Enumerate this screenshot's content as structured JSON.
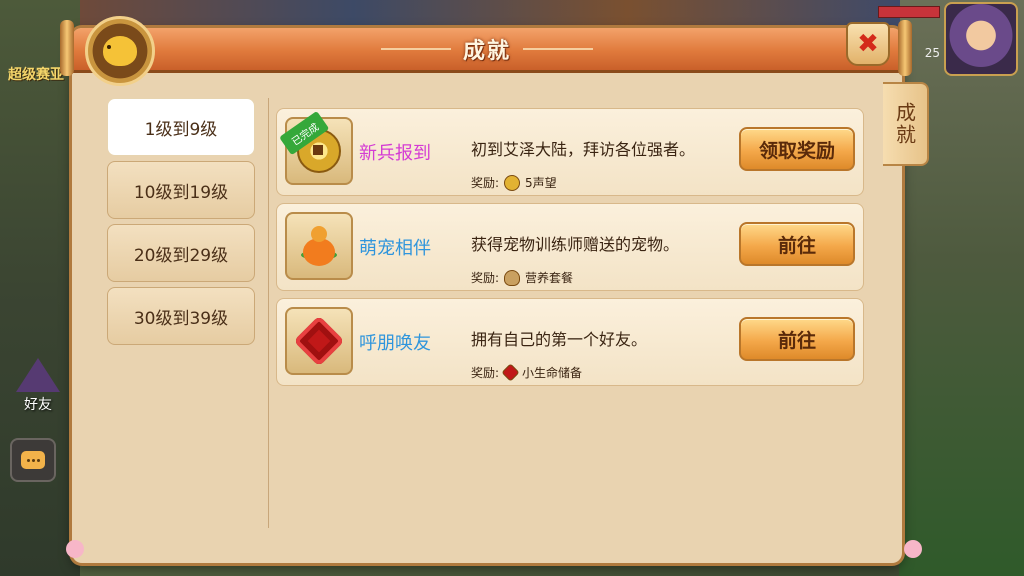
{
  "background": {
    "left_text": "超级赛亚",
    "friend_label": "好友",
    "level_number": "25"
  },
  "panel": {
    "title": "成就",
    "side_tab": "成就"
  },
  "categories": [
    {
      "label": "1级到9级",
      "active": true
    },
    {
      "label": "10级到19级",
      "active": false
    },
    {
      "label": "20级到29级",
      "active": false
    },
    {
      "label": "30级到39级",
      "active": false
    }
  ],
  "achievements": [
    {
      "icon": "coin-icon",
      "badge": "已完成",
      "name": "新兵报到",
      "description": "初到艾泽大陆，拜访各位强者。",
      "reward_prefix": "奖励:",
      "reward_icon": "coin-icon",
      "reward": "5声望",
      "button": "领取奖励"
    },
    {
      "icon": "gourd-icon",
      "badge": "",
      "name": "萌宠相伴",
      "description": "获得宠物训练师赠送的宠物。",
      "reward_prefix": "奖励:",
      "reward_icon": "bowl-icon",
      "reward": "营养套餐",
      "button": "前往"
    },
    {
      "icon": "knot-icon",
      "badge": "",
      "name": "呼朋唤友",
      "description": "拥有自己的第一个好友。",
      "reward_prefix": "奖励:",
      "reward_icon": "knot-icon",
      "reward": "小生命储备",
      "button": "前往"
    }
  ],
  "colors": {
    "title_bar": "#e07a3c",
    "panel_bg": "#e9d3b0",
    "name_magenta": "#d43cd4",
    "name_blue": "#2f95dc",
    "button": "#f4a84a",
    "close_x": "#d42a1a",
    "done_badge": "#35a83a"
  }
}
